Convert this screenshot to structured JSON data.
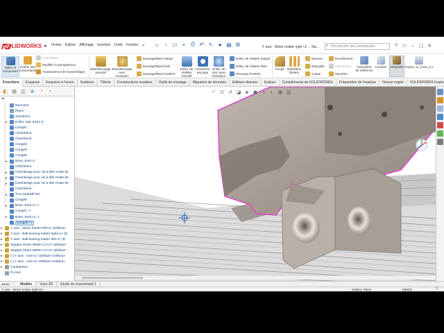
{
  "app": {
    "brand": "SOLIDWORKS"
  },
  "menus": [
    "Fichier",
    "Edition",
    "Affichage",
    "Insertion",
    "Outils",
    "Fenêtre"
  ],
  "title": "Y axis - Motor holder right <2 ... Ra...",
  "search": {
    "placeholder": "Rechercher des commandes"
  },
  "ribbon": {
    "edit_component": "Editer le composant",
    "insert_components": "Insérer des composants",
    "mates": "Contraintes",
    "modify_transparency": "Modifier la transparence",
    "assembly_transparency": "Transparence de l'assemblage",
    "bossage_extrude": "Base/Bossage extrudé",
    "bossage_revolution": "Base/Bossage avec révolution",
    "boss_sweep": "Bossage/Base balayé",
    "boss_loft": "Bossage/Base lissé",
    "boss_boundary": "Bossage/Base frontière",
    "cut_extrude": "Enlèv. de matière extrudé",
    "hole_wizard": "Assistance perçage",
    "cut_revolve": "Enlèv. de mat. avec révolution",
    "cut_sweep": "Enlèv. de matière balayé",
    "cut_loft": "Enlèv. de matière lissé",
    "cut_boundary": "Découpe frontière",
    "fillet": "Congé",
    "linear_pattern": "Répétition linéaire",
    "rib": "Nervure",
    "draft": "Dépouille",
    "shell": "Coque",
    "wrap": "Enroulement",
    "intersect": "Intersection",
    "mirror": "Symétrie",
    "ref_geometry": "Géométrie de référence",
    "curves": "Courbes",
    "instant3d": "Instant3D",
    "export": "Export_to_Cura_2.x"
  },
  "tabs": [
    "Fonctions",
    "Esquisse",
    "Esquisse à l'encre",
    "Surfaces",
    "Tôlerie",
    "Constructions soudées",
    "Outils de moulage",
    "Migration de données",
    "Editions directes",
    "Evaluer",
    "Compléments de SOLIDWORKS",
    "Préparation de l'analyse",
    "Nouvel onglet",
    "SOLIDWORKS Inspection"
  ],
  "tree": [
    {
      "label": "Nervure1",
      "color": "#6a8fc4",
      "indent": 1
    },
    {
      "label": "Plan1",
      "color": "#8aa0b8",
      "indent": 1
    },
    {
      "label": "Symétrie1",
      "color": "#5a9fd0",
      "indent": 1
    },
    {
      "label": "Enlèv. mat.-Extru.3",
      "color": "#5b84c8",
      "indent": 1,
      "exp": "▸"
    },
    {
      "label": "Congé1",
      "color": "#4f87c6",
      "indent": 1
    },
    {
      "label": "Chanfrein2",
      "color": "#4f87c6",
      "indent": 1
    },
    {
      "label": "Chanfrein3",
      "color": "#4f87c6",
      "indent": 1
    },
    {
      "label": "Congé3",
      "color": "#4f87c6",
      "indent": 1
    },
    {
      "label": "Congé4",
      "color": "#4f87c6",
      "indent": 1
    },
    {
      "label": "Congé5",
      "color": "#4f87c6",
      "indent": 1
    },
    {
      "label": "Boss.-Extru.2",
      "color": "#5b84c8",
      "indent": 1,
      "exp": "▸"
    },
    {
      "label": "Chanfrein1",
      "color": "#4f87c6",
      "indent": 1
    },
    {
      "label": "Chambrage pour vis à tête rrnide be",
      "color": "#5a7fb8",
      "indent": 1,
      "exp": "▸"
    },
    {
      "label": "Chambrage pour vis à tête rrnide be",
      "color": "#5a7fb8",
      "indent": 1,
      "exp": "▸"
    },
    {
      "label": "Chambrage pour vis à tête rrnide be",
      "color": "#5a7fb8",
      "indent": 1,
      "exp": "▸"
    },
    {
      "label": "Chanfrein4",
      "color": "#4f87c6",
      "indent": 1
    },
    {
      "label": "Trou taraudé M4",
      "color": "#5a7fb8",
      "indent": 1,
      "exp": "▸"
    },
    {
      "label": "Congé6",
      "color": "#4f87c6",
      "indent": 1
    },
    {
      "label": "Boss.-Extru.3 ->",
      "color": "#5b84c8",
      "indent": 1,
      "exp": "▸"
    },
    {
      "label": "Congé7 ->",
      "color": "#4f87c6",
      "indent": 1
    },
    {
      "label": "Boss.-Extru.4 ->",
      "color": "#5b84c8",
      "indent": 1,
      "exp": "▸"
    },
    {
      "label": "Congé8 ->",
      "color": "#4f87c6",
      "indent": 1,
      "selected": true
    },
    {
      "label": "Y axis - Motor holder left<1> (Défaut<",
      "color": "#c9a43c",
      "indent": 0,
      "exp": "▸"
    },
    {
      "label": "Y axis - Ball bearing holder right<1> (D",
      "color": "#c9a43c",
      "indent": 0,
      "exp": "▸"
    },
    {
      "label": "Y axis - Ball bearing holder left<1> (D",
      "color": "#c9a43c",
      "indent": 0,
      "exp": "▸"
    },
    {
      "label": "Stepper Motor NEMA-17<1> (Défaut<",
      "color": "#c9a43c",
      "indent": 0,
      "exp": "▸"
    },
    {
      "label": "Stepper Motor NEMA-17<2> (Défaut<",
      "color": "#c9a43c",
      "indent": 0,
      "exp": "▸"
    },
    {
      "label": "(-) Y axis - Axe<1> (Défaut<<Défaut>",
      "color": "#c9a43c",
      "indent": 0,
      "exp": "▸"
    },
    {
      "label": "(-) Y axis - Axe<2> (Défaut<<Défaut>",
      "color": "#c9a43c",
      "indent": 0,
      "exp": "▸"
    },
    {
      "label": "Contraintes",
      "color": "#9a9a9a",
      "indent": 0,
      "exp": "▸"
    },
    {
      "label": "PLAN1",
      "color": "#8aa0b8",
      "indent": 0
    }
  ],
  "model_tabs": [
    "Modèle",
    "Vues 3D",
    "Etude de mouvement 1"
  ],
  "status": {
    "left": "Y axis - Motor holder right<2>",
    "edit": "Edition: Pièce",
    "units": "MMGS"
  }
}
